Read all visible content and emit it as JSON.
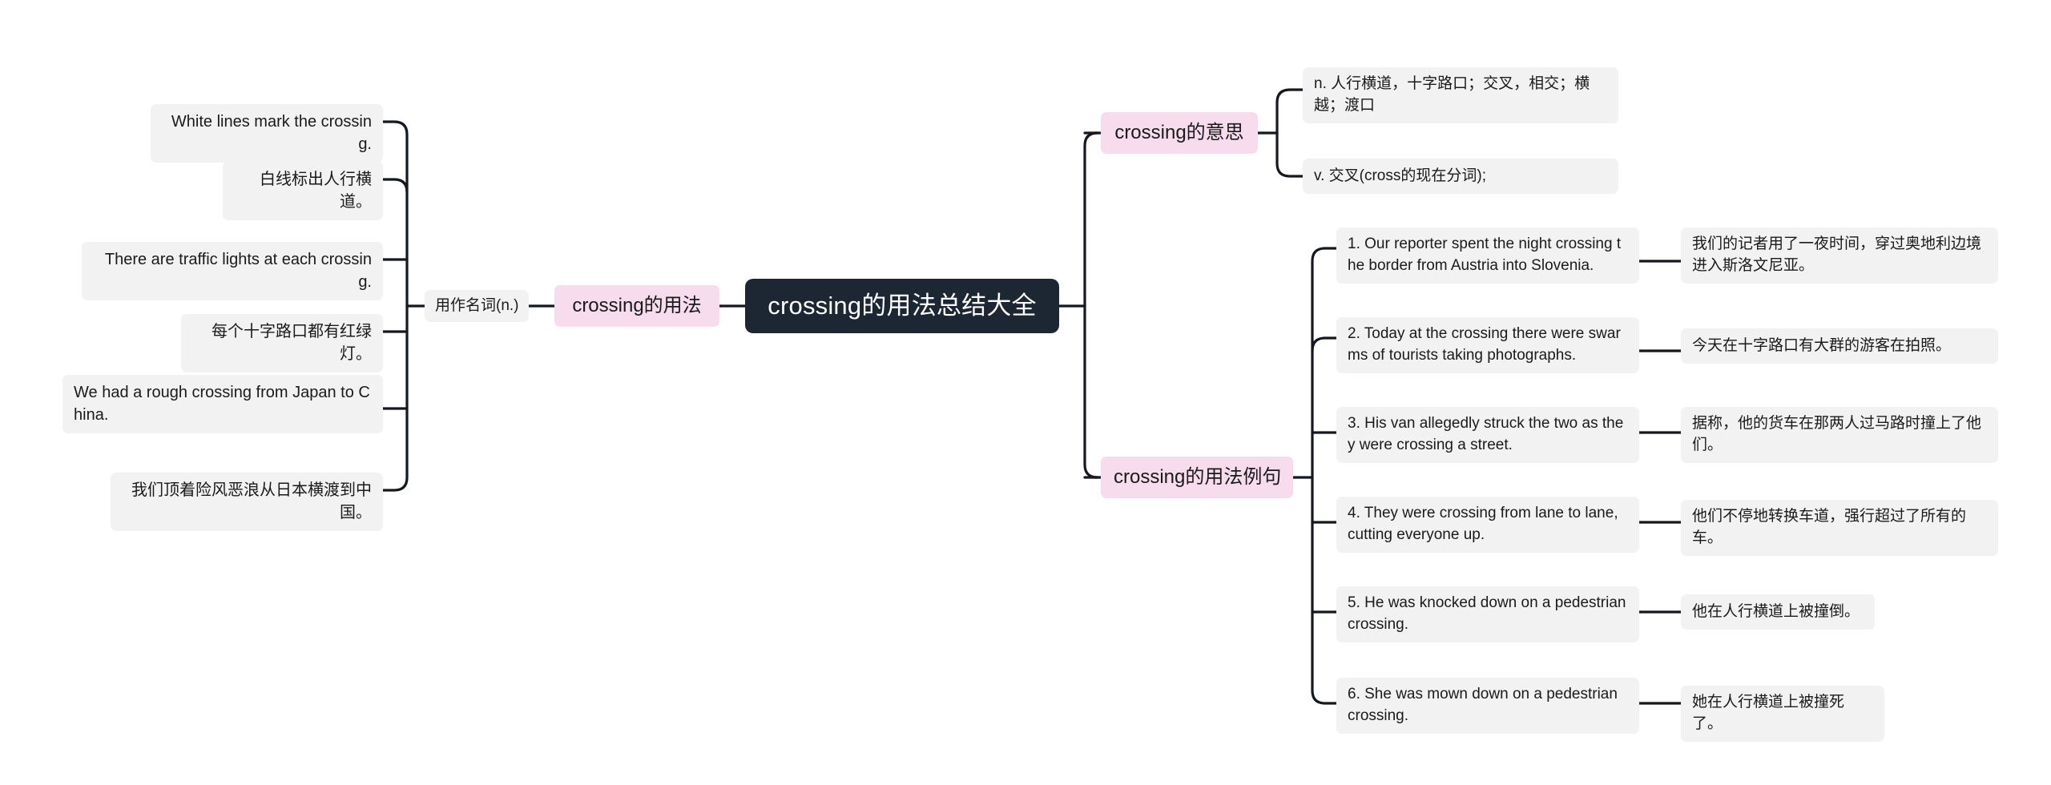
{
  "map": {
    "root": {
      "label": "crossing的用法总结大全"
    },
    "branches": {
      "usage": {
        "label": "crossing的用法",
        "subbranch": {
          "label": "用作名词(n.)"
        },
        "leaves": [
          {
            "text": "White lines mark the crossing."
          },
          {
            "text": "白线标出人行横道。"
          },
          {
            "text": "There are traffic lights at each crossing."
          },
          {
            "text": "每个十字路口都有红绿灯。"
          },
          {
            "text": "We had a rough crossing from Japan to China."
          },
          {
            "text": "我们顶着险风恶浪从日本横渡到中国。"
          }
        ]
      },
      "meaning": {
        "label": "crossing的意思",
        "leaves": [
          {
            "text": "n. 人行横道，十字路口；交叉，相交；横越；渡口"
          },
          {
            "text": "v. 交叉(cross的现在分词);"
          }
        ]
      },
      "examples": {
        "label": "crossing的用法例句",
        "items": [
          {
            "en": "1. Our reporter spent the night crossing the border from Austria into Slovenia.",
            "zh": "我们的记者用了一夜时间，穿过奥地利边境进入斯洛文尼亚。"
          },
          {
            "en": "2. Today at the crossing there were swarms of tourists taking photographs.",
            "zh": "今天在十字路口有大群的游客在拍照。"
          },
          {
            "en": "3. His van allegedly struck the two as they were crossing a street.",
            "zh": "据称，他的货车在那两人过马路时撞上了他们。"
          },
          {
            "en": "4. They were crossing from lane to lane, cutting everyone up.",
            "zh": "他们不停地转换车道，强行超过了所有的车。"
          },
          {
            "en": "5. He was knocked down on a pedestrian crossing.",
            "zh": "他在人行横道上被撞倒。"
          },
          {
            "en": "6. She was mown down on a pedestrian crossing.",
            "zh": "她在人行横道上被撞死了。"
          }
        ]
      }
    }
  },
  "colors": {
    "root_bg": "#1d2733",
    "root_text": "#ffffff",
    "branch_pink": "#f7dced",
    "leaf_gray": "#f2f2f2",
    "connector": "#14181f",
    "text": "#1a1a1a"
  }
}
